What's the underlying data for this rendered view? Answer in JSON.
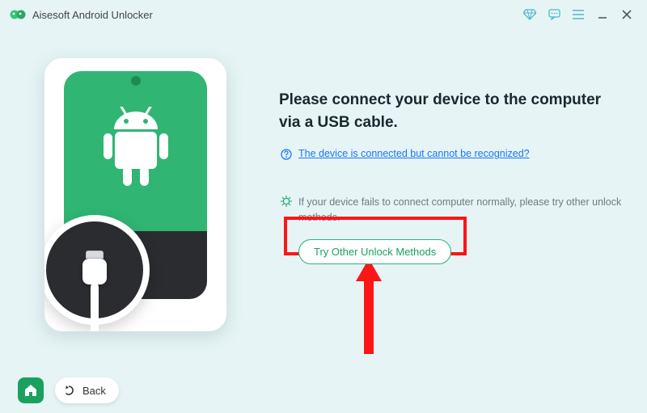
{
  "app": {
    "title": "Aisesoft Android Unlocker"
  },
  "main": {
    "headline": "Please connect your device to the computer via a USB cable.",
    "help_link": "The device is connected but cannot be recognized?",
    "hint": "If your device fails to connect computer normally, please try other unlock methods.",
    "try_button": "Try Other Unlock Methods"
  },
  "footer": {
    "back": "Back"
  },
  "colors": {
    "accent_green": "#1aa15e",
    "link_blue": "#1677ff",
    "annotation_red": "#fd1616"
  }
}
